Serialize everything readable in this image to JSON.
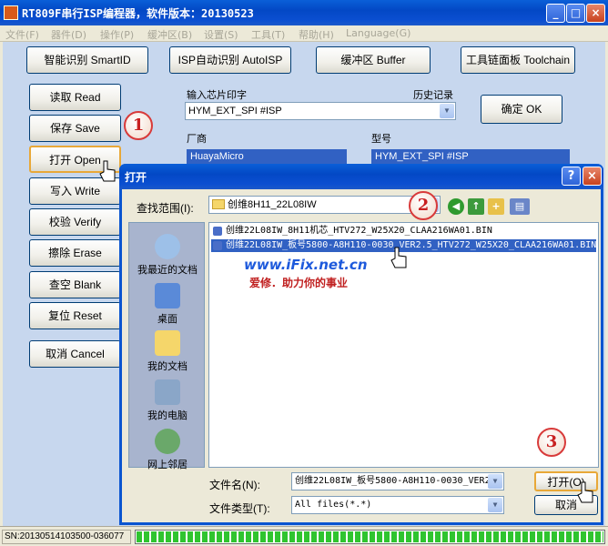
{
  "window": {
    "title": "RT809F串行ISP编程器，软件版本：20130523",
    "minimize": "_",
    "maximize": "□",
    "close": "×"
  },
  "menu": [
    "文件(F)",
    "器件(D)",
    "操作(P)",
    "缓冲区(B)",
    "设置(S)",
    "工具(T)",
    "帮助(H)",
    "Language(G)"
  ],
  "top_buttons": [
    "智能识别 SmartID",
    "ISP自动识别 AutoISP",
    "缓冲区 Buffer",
    "工具链面板 Toolchain"
  ],
  "side_buttons": [
    "读取 Read",
    "保存 Save",
    "打开 Open",
    "写入 Write",
    "校验 Verify",
    "擦除 Erase",
    "查空 Blank",
    "复位 Reset",
    "取消 Cancel"
  ],
  "chip_section": {
    "input_label": "输入芯片印字",
    "history_label": "历史记录",
    "chip_value": "HYM_EXT_SPI #ISP",
    "confirm_button": "确定 OK",
    "vendor_label": "厂商",
    "vendor_value": "HuayaMicro",
    "model_label": "型号",
    "model_value": "HYM_EXT_SPI #ISP"
  },
  "status": {
    "sn": "SN:20130514103500-036077",
    "progress": 1.0
  },
  "dialog": {
    "title": "打开",
    "help": "?",
    "close": "×",
    "lookin_label": "查找范围(I):",
    "lookin_value": "创维8H11_22L08IW",
    "places": [
      "我最近的文档",
      "桌面",
      "我的文档",
      "我的电脑",
      "网上邻居"
    ],
    "files": [
      "创维22L08IW_8H11机芯_HTV272_W25X20_CLAA216WA01.BIN",
      "创维22L08IW_板号5800-A8H110-0030_VER2.5_HTV272_W25X20_CLAA216WA01.BIN"
    ],
    "selected_index": 1,
    "filename_label": "文件名(N):",
    "filename_value": "创维22L08IW_板号5800-A8H110-0030_VER2.",
    "filetype_label": "文件类型(T):",
    "filetype_value": "All files(*.*)",
    "open_button": "打开(O)",
    "cancel_button": "取消"
  },
  "watermark": {
    "url": "www.iFix.net.cn",
    "slogan": "爱修．助力你的事业"
  },
  "callouts": [
    "1",
    "2",
    "3"
  ],
  "colors": {
    "titlebar_blue": "#0348c5",
    "client_bg": "#c7d7ee",
    "selection": "#3161c3",
    "callout_red": "#d83a3a",
    "progress_green": "#2fc42f"
  }
}
